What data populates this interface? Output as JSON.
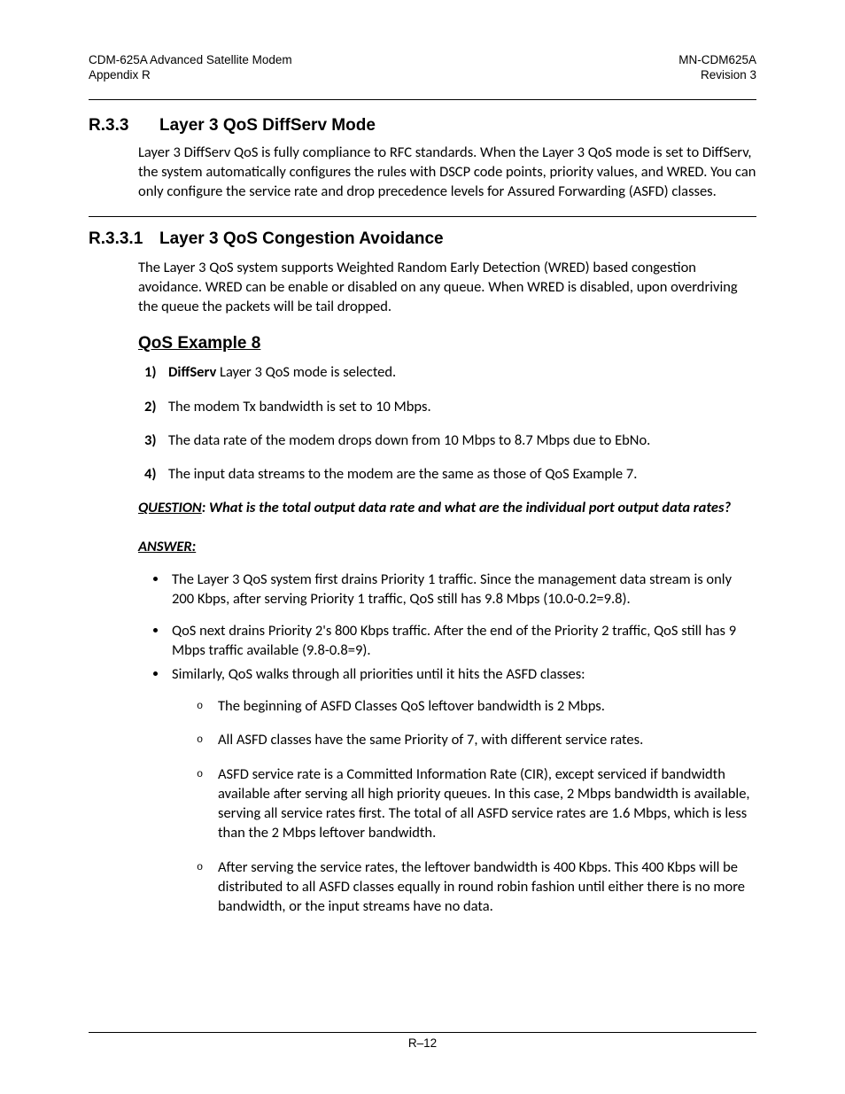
{
  "header": {
    "left_line1": "CDM-625A Advanced Satellite Modem",
    "left_line2": "Appendix R",
    "right_line1": "MN-CDM625A",
    "right_line2": "Revision 3"
  },
  "section_r33": {
    "number": "R.3.3",
    "title": "Layer 3 QoS DiffServ Mode",
    "para": "Layer 3 DiffServ QoS is fully compliance to RFC standards. When the Layer 3 QoS mode is set to DiffServ, the system automatically configures the rules with DSCP code points, priority values, and WRED. You can only configure the service rate and drop precedence levels for Assured Forwarding (ASFD) classes."
  },
  "section_r331": {
    "number": "R.3.3.1",
    "title": "Layer 3 QoS Congestion Avoidance",
    "para": "The Layer 3 QoS system supports Weighted Random Early Detection (WRED) based congestion avoidance. WRED can be enable or disabled on any queue. When WRED is disabled, upon overdriving the queue the packets will be tail dropped."
  },
  "example": {
    "title": "QoS Example 8",
    "items": {
      "i1_bold": "DiffServ",
      "i1_rest": " Layer 3 QoS mode is selected.",
      "i2": "The modem Tx bandwidth is set to 10 Mbps.",
      "i3": "The data rate of the modem drops down from 10 Mbps to 8.7 Mbps due to EbNo.",
      "i4": "The input data streams to the modem are the same as those of QoS Example 7."
    }
  },
  "question": {
    "label": "QUESTION",
    "text": ": What is the total output data rate and what are the individual port output data rates?"
  },
  "answer_label": "ANSWER:",
  "bullets": {
    "b1": "The Layer 3 QoS system first drains Priority 1 traffic. Since the management data stream is only 200 Kbps, after serving Priority 1 traffic, QoS still has 9.8 Mbps (10.0-0.2=9.8).",
    "b2": "QoS next drains Priority 2's 800 Kbps traffic. After the end of the Priority 2 traffic, QoS still has 9 Mbps traffic available (9.8-0.8=9).",
    "b3": "Similarly, QoS walks through all priorities until it hits the ASFD classes:",
    "sub": {
      "s1": "The beginning of ASFD Classes QoS leftover bandwidth is 2 Mbps.",
      "s2": "All ASFD classes have the same Priority of 7, with different service rates.",
      "s3": "ASFD service rate is a Committed Information Rate (CIR), except serviced if   bandwidth available after serving all high priority queues. In this case, 2 Mbps bandwidth is available, serving all service rates first. The total of all ASFD service rates are 1.6 Mbps, which is less than the 2 Mbps leftover bandwidth.",
      "s4": "After serving the service rates, the leftover bandwidth is 400 Kbps. This 400 Kbps will be distributed to all ASFD classes equally in round robin fashion until either there is no more bandwidth, or the input streams have no data."
    }
  },
  "footer": "R–12"
}
